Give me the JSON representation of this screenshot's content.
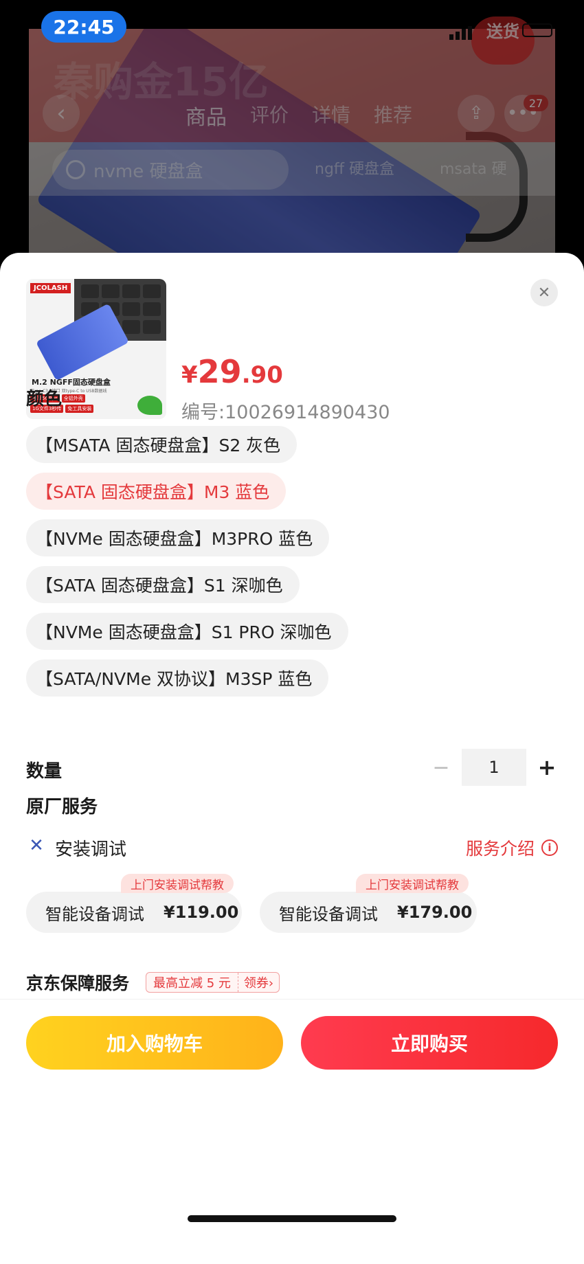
{
  "status_bar": {
    "time": "22:45"
  },
  "background_page": {
    "promo_badge": "送货",
    "watermark": "秦购金15亿",
    "nav_back_icon": "chevron-left-icon",
    "tabs": [
      "商品",
      "评价",
      "详情",
      "推荐"
    ],
    "active_tab": "商品",
    "cart_badge": "27",
    "search_text": "nvme 硬盘盒",
    "chips": [
      "ngff 硬盘盒",
      "msata 硬"
    ]
  },
  "product": {
    "thumbnail": {
      "brand": "JCOLASH",
      "title": "M.2 NGFF固态硬盘盒",
      "subtitle": "Type-C3.1接口 双type-C to USB数据线",
      "tags": [
        "速率5GBps",
        "全铝外壳",
        "1G文件3秒传",
        "免工具安装"
      ]
    },
    "price_currency": "¥",
    "price_integer": "29",
    "price_decimal": ".90",
    "sku_label": "编号:10026914890430"
  },
  "color_section": {
    "title": "颜色",
    "options": [
      "【MSATA 固态硬盘盒】S2 灰色",
      "【SATA 固态硬盘盒】M3 蓝色",
      "【NVMe 固态硬盘盒】M3PRO 蓝色",
      "【SATA 固态硬盘盒】S1 深咖色",
      "【NVMe 固态硬盘盒】S1 PRO 深咖色",
      "【SATA/NVMe 双协议】M3SP 蓝色"
    ],
    "selected_index": 1
  },
  "quantity": {
    "title": "数量",
    "value": "1",
    "minus": "−",
    "plus": "+"
  },
  "service": {
    "title": "原厂服务",
    "install_label": "安装调试",
    "intro_link": "服务介绍",
    "cards": [
      {
        "tag": "上门安装调试帮教",
        "name": "智能设备调试",
        "price": "¥119.00"
      },
      {
        "tag": "上门安装调试帮教",
        "name": "智能设备调试",
        "price": "¥179.00"
      }
    ]
  },
  "guarantee": {
    "title": "京东保障服务",
    "coupon_text": "最高立减 5 元",
    "coupon_action": "领券›"
  },
  "actions": {
    "add_to_cart": "加入购物车",
    "buy_now": "立即购买"
  },
  "colors": {
    "accent": "#e4393c",
    "cart_button": "#ffc21e",
    "buy_button": "#f6292c",
    "status_pill": "#1a73e8"
  }
}
